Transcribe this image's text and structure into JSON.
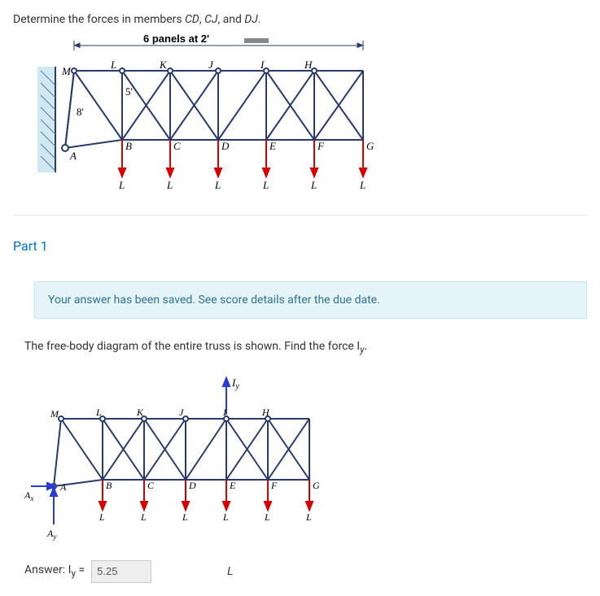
{
  "question": "Determine the forces in members CD, CJ, and DJ.",
  "part_title": "Part 1",
  "info_message": "Your answer has been saved. See score details after the due date.",
  "body_text": "The free-body diagram of the entire truss is shown. Find the force I",
  "body_text_sub": "y",
  "body_text_end": ".",
  "answer_label": "Answer: I",
  "answer_label_sub": "y",
  "answer_label_eq": " =",
  "answer_value": "5.25",
  "answer_unit": "L",
  "fig": {
    "panels": "6 panels at 2'",
    "M": "M",
    "L": "L",
    "K": "K",
    "J": "J",
    "I": "I",
    "H": "H",
    "A": "A",
    "B": "B",
    "C": "C",
    "D": "D",
    "E": "E",
    "F": "F",
    "G": "G",
    "dim8": "8'",
    "dim5": "5'",
    "Iy": "I",
    "Iy_sub": "y",
    "Ax": "A",
    "Ax_sub": "x",
    "Ay": "A",
    "Ay_sub": "y"
  }
}
